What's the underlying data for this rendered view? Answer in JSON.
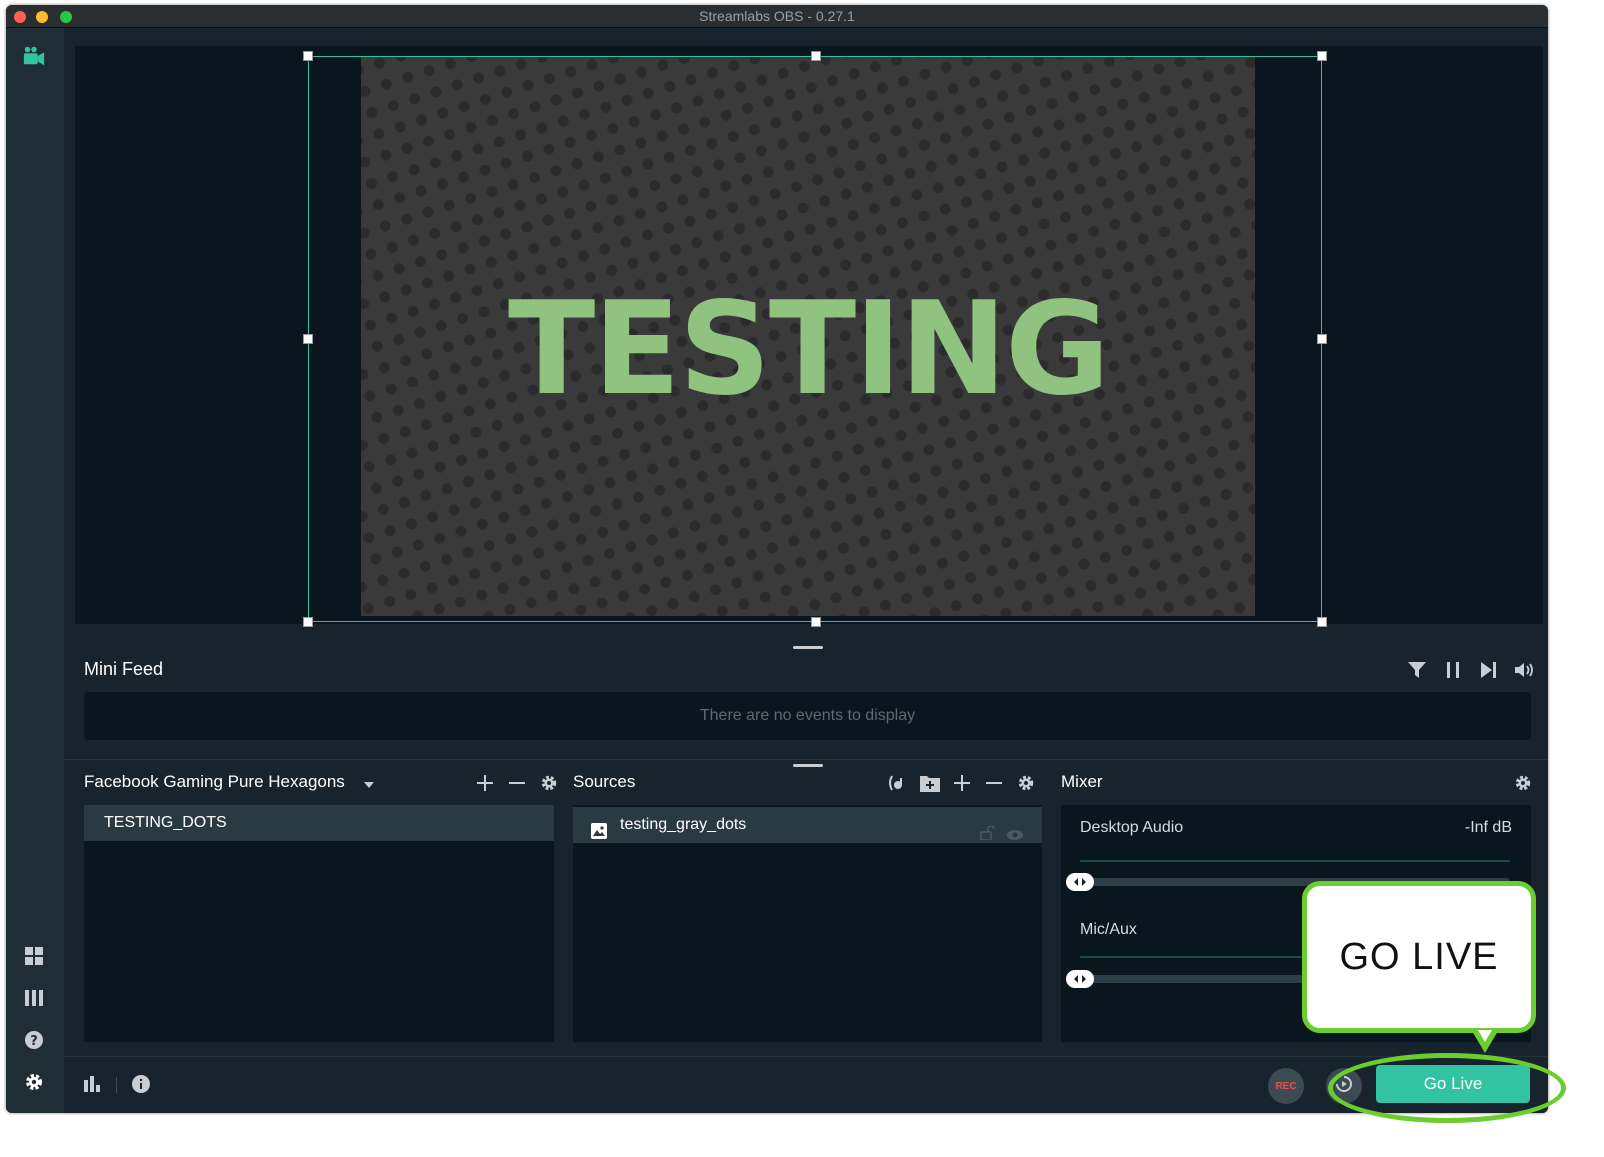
{
  "window": {
    "title": "Streamlabs OBS - 0.27.1"
  },
  "preview": {
    "canvas_text": "TESTING"
  },
  "mini_feed": {
    "title": "Mini Feed",
    "empty_text": "There are no events to display",
    "tools": [
      "filter-icon",
      "pause-icon",
      "skip-icon",
      "volume-icon"
    ]
  },
  "scenes": {
    "collection_name": "Facebook Gaming Pure Hexagons",
    "items": [
      {
        "label": "TESTING_DOTS"
      }
    ]
  },
  "sources": {
    "title": "Sources",
    "items": [
      {
        "label": "testing_gray_dots",
        "icon": "image-icon"
      }
    ]
  },
  "mixer": {
    "title": "Mixer",
    "channels": [
      {
        "label": "Desktop Audio",
        "level": "-Inf dB",
        "volume": 0
      },
      {
        "label": "Mic/Aux",
        "level": "",
        "volume": 0
      }
    ]
  },
  "footer": {
    "rec_label": "REC",
    "go_live_label": "Go Live"
  },
  "annotation": {
    "callout_text": "GO LIVE",
    "accent": "#6ccd2f"
  },
  "colors": {
    "teal": "#31c3a2",
    "bg": "#17242d",
    "panel": "#09161d"
  }
}
